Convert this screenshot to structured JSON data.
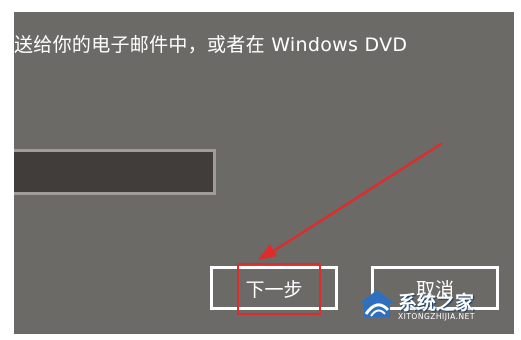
{
  "dialog": {
    "description_text": "送给你的电子邮件中，或者在 Windows DVD",
    "input_value": "",
    "next_button_label": "下一步",
    "cancel_button_label": "取消"
  },
  "annotation": {
    "highlight_color": "#e02b2b",
    "arrow_color": "#e02b2b"
  },
  "watermark": {
    "title": "系统之家",
    "subtitle": "XITONGZHIJIA.NET",
    "logo_icon": "house-logo-icon"
  },
  "colors": {
    "panel_background": "#6b6a67",
    "field_background": "#403d3b",
    "field_border": "#9e9b98",
    "button_border": "#ffffff",
    "text": "#ffffff"
  }
}
